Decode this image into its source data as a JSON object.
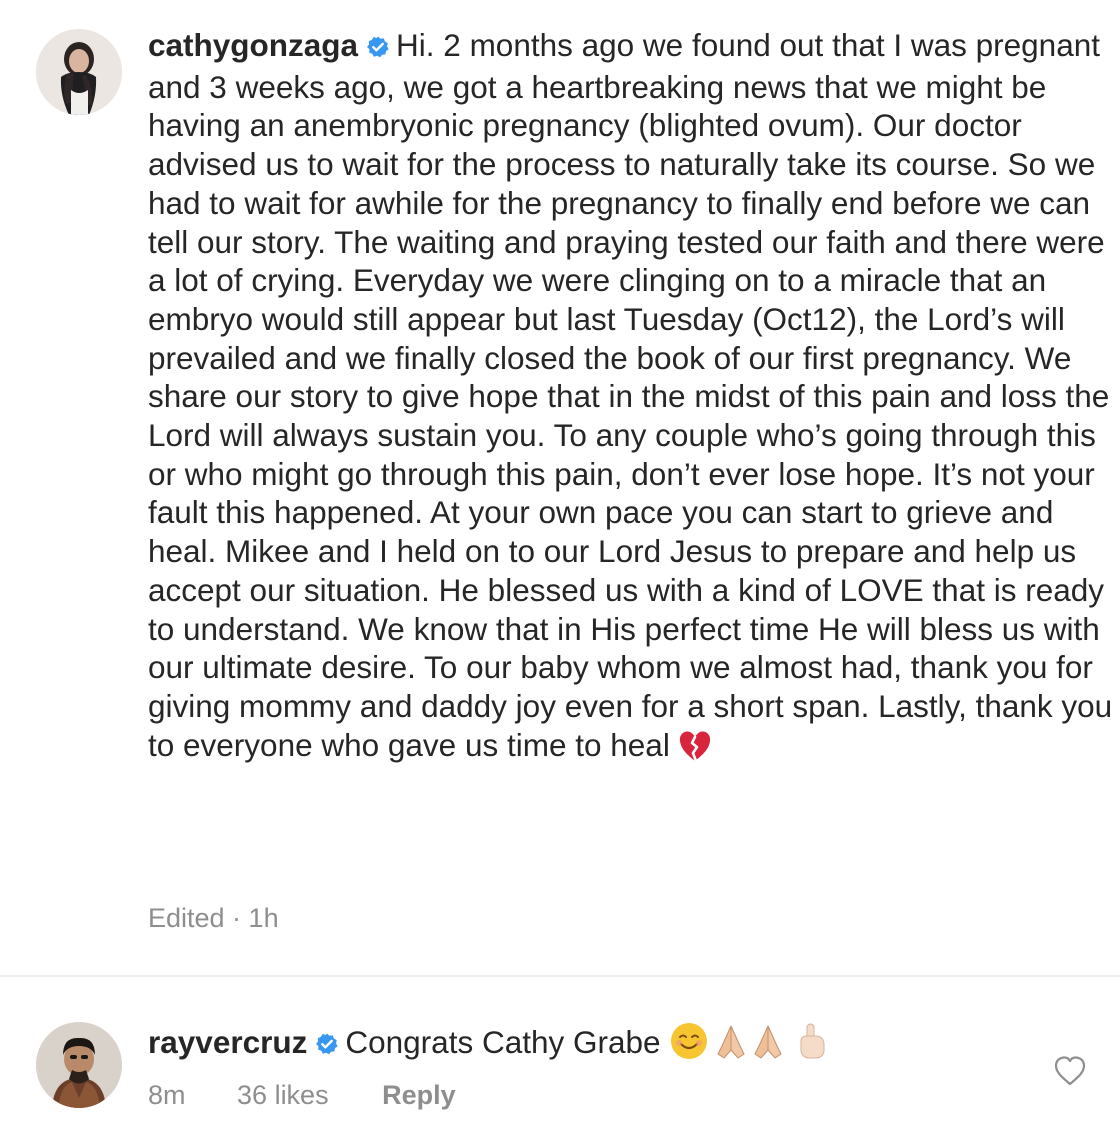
{
  "post": {
    "username": "cathygonzaga",
    "caption": "Hi. 2 months ago we found out that I was pregnant and 3 weeks ago, we got a heartbreaking news that we might be having an anembryonic pregnancy (blighted ovum). Our doctor advised us to wait for the process to naturally take its course. So we had to wait for awhile for the pregnancy to finally end before we can tell our story. The waiting and praying tested our faith and there were a lot of crying. Everyday we were clinging on to a miracle that an embryo would still appear but last Tuesday (Oct12), the Lord’s will prevailed and we finally closed the book of our first pregnancy. We share our story to give hope that in the midst of this pain and loss the Lord will always sustain you. To any couple who’s going through this or who might go through this pain,  don’t ever lose hope. It’s not your fault this happened.  At your own pace you can start to grieve and heal. Mikee and I held on to our Lord Jesus to prepare and help us accept our situation. He blessed us with a kind of LOVE that is ready to understand. We know that in His perfect time He will bless us with our ultimate desire. To our baby whom we almost had, thank you for giving mommy and daddy joy even for a short span. Lastly, thank you to everyone who gave us time to heal",
    "meta": "Edited · 1h",
    "emoji": "broken-heart"
  },
  "comment": {
    "username": "rayvercruz",
    "text": "Congrats Cathy Grabe",
    "emojis": [
      "smiling-face",
      "folded-hands",
      "folded-hands",
      "index-pointing-up"
    ],
    "time": "8m",
    "likes": "36 likes",
    "reply": "Reply"
  },
  "colors": {
    "text": "#262626",
    "muted": "#8e8e8e",
    "verified": "#3897f0",
    "divider": "#ededed",
    "broken_heart": "#d9243d"
  }
}
